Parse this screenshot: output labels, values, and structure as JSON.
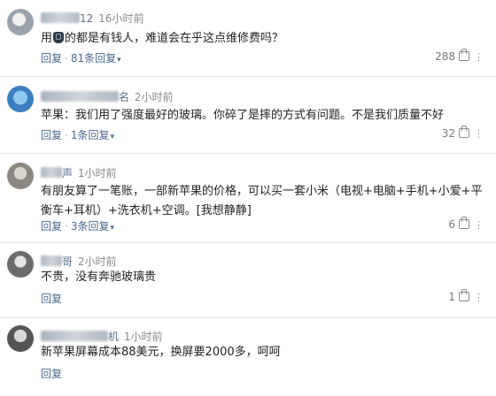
{
  "comments": [
    {
      "user_visible": "12",
      "time": "16小时前",
      "text_before": "用",
      "text_after": "的都是有钱人，难道会在乎这点维修费吗？",
      "reply_label": "回复",
      "replies_link": "81条回复",
      "likes": "288"
    },
    {
      "user_visible": "名",
      "time": "2小时前",
      "text": "苹果：我们用了强度最好的玻璃。你碎了是摔的方式有问题。不是我们质量不好",
      "reply_label": "回复",
      "replies_link": "1条回复",
      "likes": "32"
    },
    {
      "user_visible": "声",
      "time": "1小时前",
      "text": "有朋友算了一笔账，一部新苹果的价格，可以买一套小米（电视+电脑+手机+小爱+平衡车+耳机）+洗衣机+空调。[我想静静]",
      "reply_label": "回复",
      "replies_link": "3条回复",
      "likes": "6"
    },
    {
      "user_visible": "哥",
      "time": "2小时前",
      "text": "不贵，没有奔驰玻璃贵",
      "reply_label": "回复",
      "likes": "1"
    },
    {
      "user_visible": "机",
      "time": "1小时前",
      "text": "新苹果屏幕成本88美元，换屏要2000多，呵呵",
      "reply_label": "回复"
    }
  ],
  "icons": {
    "thumb": "thumbs-up-icon",
    "more": "more-icon",
    "chevron": "chevron-down-icon",
    "emoji": "phone-emoji-icon"
  }
}
